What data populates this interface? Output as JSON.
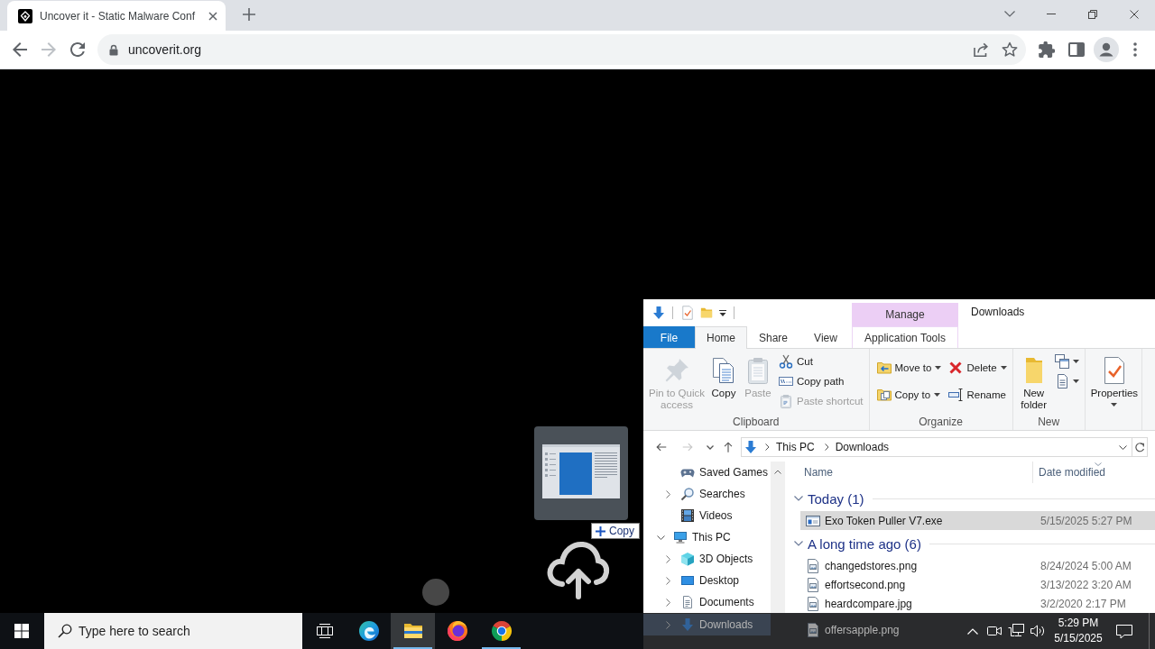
{
  "browser": {
    "tabs": [
      {
        "title": "Uncover it - Static Malware Conf",
        "selected": true
      }
    ],
    "nav_buttons": [
      {
        "kind": "back",
        "disabled": false
      },
      {
        "kind": "forward",
        "disabled": true
      },
      {
        "kind": "reload",
        "disabled": false
      }
    ],
    "address": "uncoverit.org"
  },
  "page": {
    "copy_tooltip": "Copy"
  },
  "explorer": {
    "contextual_group": "Manage",
    "title": "Downloads",
    "ribbon_tabs": [
      {
        "label": "File",
        "kind": "file",
        "selected": false
      },
      {
        "label": "Home",
        "kind": "standard",
        "selected": true
      },
      {
        "label": "Share",
        "kind": "standard",
        "selected": false
      },
      {
        "label": "View",
        "kind": "standard",
        "selected": false
      },
      {
        "label": "Application Tools",
        "kind": "contextual",
        "selected": false
      }
    ],
    "ribbon_groups": [
      {
        "label": "Clipboard",
        "columns": [
          [
            {
              "kind": "pin",
              "large": true,
              "label_lines": [
                "Pin to Quick",
                "access"
              ],
              "disabled": true,
              "dropdown": false
            }
          ],
          [
            {
              "kind": "copy",
              "large": true,
              "label_lines": [
                "Copy"
              ],
              "disabled": false,
              "dropdown": false
            }
          ],
          [
            {
              "kind": "paste",
              "large": true,
              "label_lines": [
                "Paste"
              ],
              "disabled": true,
              "dropdown": false
            }
          ],
          [
            {
              "kind": "cut",
              "large": false,
              "label": "Cut",
              "disabled": false,
              "dropdown": false
            },
            {
              "kind": "copypath",
              "large": false,
              "label": "Copy path",
              "disabled": false,
              "dropdown": false
            },
            {
              "kind": "pasteshortcut",
              "large": false,
              "label": "Paste shortcut",
              "disabled": true,
              "dropdown": false
            }
          ]
        ]
      },
      {
        "label": "Organize",
        "columns": [
          [
            {
              "kind": "moveto",
              "large": false,
              "label": "Move to",
              "disabled": false,
              "dropdown": true
            },
            {
              "kind": "copyto",
              "large": false,
              "label": "Copy to",
              "disabled": false,
              "dropdown": true
            }
          ],
          [
            {
              "kind": "delete",
              "large": false,
              "label": "Delete",
              "disabled": false,
              "dropdown": true
            },
            {
              "kind": "rename",
              "large": false,
              "label": "Rename",
              "disabled": false,
              "dropdown": false
            }
          ]
        ]
      },
      {
        "label": "New",
        "columns": [
          [
            {
              "kind": "newfolder",
              "large": true,
              "label_lines": [
                "New",
                "folder"
              ],
              "disabled": false,
              "dropdown": false
            }
          ],
          [
            {
              "kind": "newitem",
              "large": false,
              "disabled": false,
              "dropdown": true
            },
            {
              "kind": "easyaccess",
              "large": false,
              "disabled": false,
              "dropdown": true
            }
          ]
        ]
      },
      {
        "columns": [
          [
            {
              "kind": "properties",
              "large": true,
              "label_lines": [
                "Properties"
              ],
              "disabled": false,
              "dropdown": true
            }
          ]
        ]
      }
    ],
    "nav_buttons": [
      {
        "kind": "back",
        "disabled": false
      },
      {
        "kind": "forward",
        "disabled": true
      },
      {
        "kind": "recent",
        "disabled": false
      },
      {
        "kind": "up",
        "disabled": false
      }
    ],
    "breadcrumb": [
      "This PC",
      "Downloads"
    ],
    "nav_pane": {
      "partial_children": [
        {
          "label": "Saved Games",
          "kind": "games",
          "expandable": false,
          "selected": false
        },
        {
          "label": "Searches",
          "kind": "searches",
          "expandable": true,
          "expanded": false,
          "selected": false
        },
        {
          "label": "Videos",
          "kind": "videos",
          "expandable": false,
          "selected": false
        }
      ],
      "tree": [
        {
          "label": "This PC",
          "kind": "computer",
          "expandable": true,
          "expanded": true,
          "selected": false,
          "children": [
            {
              "label": "3D Objects",
              "kind": "objects",
              "expandable": true,
              "expanded": false,
              "selected": false
            },
            {
              "label": "Desktop",
              "kind": "desktop",
              "expandable": true,
              "expanded": false,
              "selected": false
            },
            {
              "label": "Documents",
              "kind": "documents",
              "expandable": true,
              "expanded": false,
              "selected": false
            }
          ]
        }
      ]
    },
    "columns": [
      {
        "label": "Name",
        "sorted": false
      },
      {
        "label": "Date modified",
        "sorted": true
      }
    ],
    "file_groups": [
      {
        "label": "Today (1)",
        "expanded": true,
        "files": [
          {
            "name": "Exo Token Puller V7.exe",
            "kind": "application",
            "date": "5/15/2025 5:27 PM",
            "selected": true
          }
        ]
      },
      {
        "label": "A long time ago (6)",
        "expanded": true,
        "files": [
          {
            "name": "changedstores.png",
            "kind": "image",
            "date": "8/24/2024 5:00 AM",
            "selected": false
          },
          {
            "name": "effortsecond.png",
            "kind": "image",
            "date": "3/13/2022 3:20 AM",
            "selected": false
          },
          {
            "name": "heardcompare.jpg",
            "kind": "image",
            "date": "3/2/2020 2:17 PM",
            "selected": false
          }
        ]
      }
    ],
    "behind_taskbar": {
      "tree_item": {
        "label": "Downloads",
        "kind": "downloads",
        "expandable": true,
        "expanded": false,
        "selected": true
      },
      "file_row": {
        "name": "offersapple.png",
        "kind": "image",
        "selected": false
      }
    }
  },
  "taskbar": {
    "search_placeholder": "Type here to search",
    "apps": [
      {
        "kind": "edge",
        "active": false,
        "running": false
      },
      {
        "kind": "explorer",
        "active": true,
        "running": true
      },
      {
        "kind": "firefox",
        "active": false,
        "running": false
      },
      {
        "kind": "chrome",
        "active": false,
        "running": true
      }
    ],
    "time": "5:29 PM",
    "date": "5/15/2025"
  }
}
